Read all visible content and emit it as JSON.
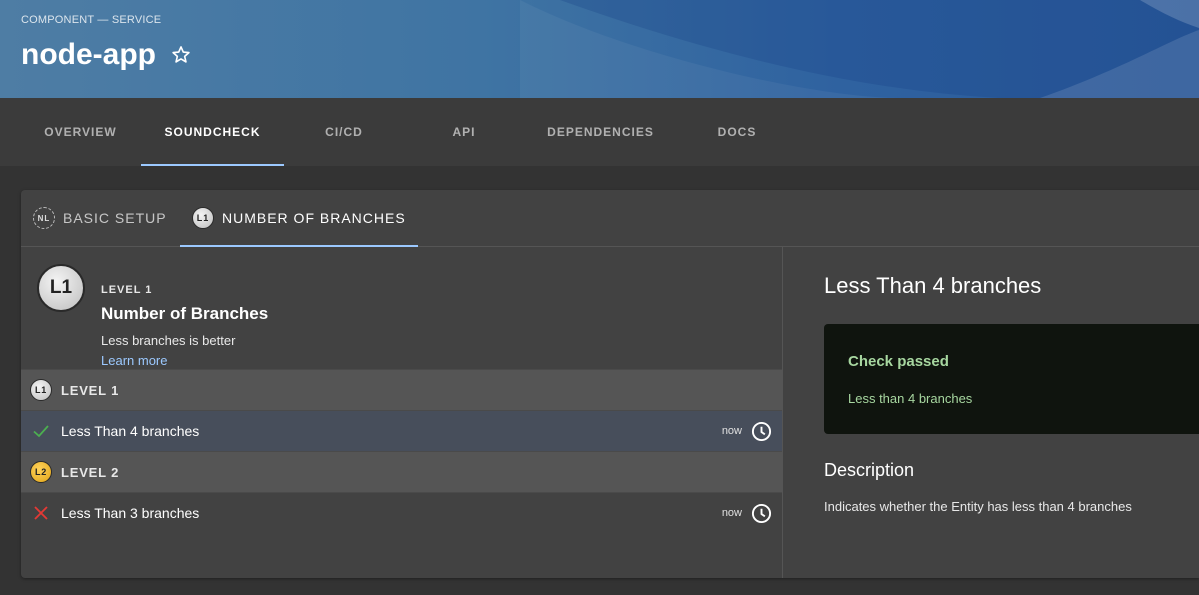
{
  "header": {
    "breadcrumb": "COMPONENT — SERVICE",
    "title": "node-app",
    "favorite_icon": "star-outline-icon"
  },
  "tabs": [
    {
      "label": "OVERVIEW",
      "active": false
    },
    {
      "label": "SOUNDCHECK",
      "active": true
    },
    {
      "label": "CI/CD",
      "active": false
    },
    {
      "label": "API",
      "active": false
    },
    {
      "label": "DEPENDENCIES",
      "active": false
    },
    {
      "label": "DOCS",
      "active": false
    }
  ],
  "subtabs": [
    {
      "badge": "NL",
      "label": "BASIC SETUP",
      "active": false
    },
    {
      "badge": "L1",
      "label": "NUMBER OF BRANCHES",
      "active": true
    }
  ],
  "level_info": {
    "badge": "L1",
    "kicker": "LEVEL 1",
    "title": "Number of Branches",
    "description": "Less branches is better",
    "learn_more": "Learn more"
  },
  "groups": [
    {
      "badge": "L1",
      "label": "LEVEL 1",
      "checks": [
        {
          "label": "Less Than 4 branches",
          "status": "passed",
          "status_icon": "check-icon",
          "time": "now",
          "history_icon": "clock-icon",
          "selected": true
        }
      ]
    },
    {
      "badge": "L2",
      "label": "LEVEL 2",
      "checks": [
        {
          "label": "Less Than 3 branches",
          "status": "failed",
          "status_icon": "x-icon",
          "time": "now",
          "history_icon": "clock-icon",
          "selected": false
        }
      ]
    }
  ],
  "detail": {
    "title": "Less Than 4 branches",
    "result_title": "Check passed",
    "result_text": "Less than 4 branches",
    "description_heading": "Description",
    "description": "Indicates whether the Entity has less than 4 branches"
  },
  "colors": {
    "accent": "#9cc9ff",
    "passed": "#4caf50",
    "failed": "#e53935",
    "result_text": "#a7d7a0"
  }
}
